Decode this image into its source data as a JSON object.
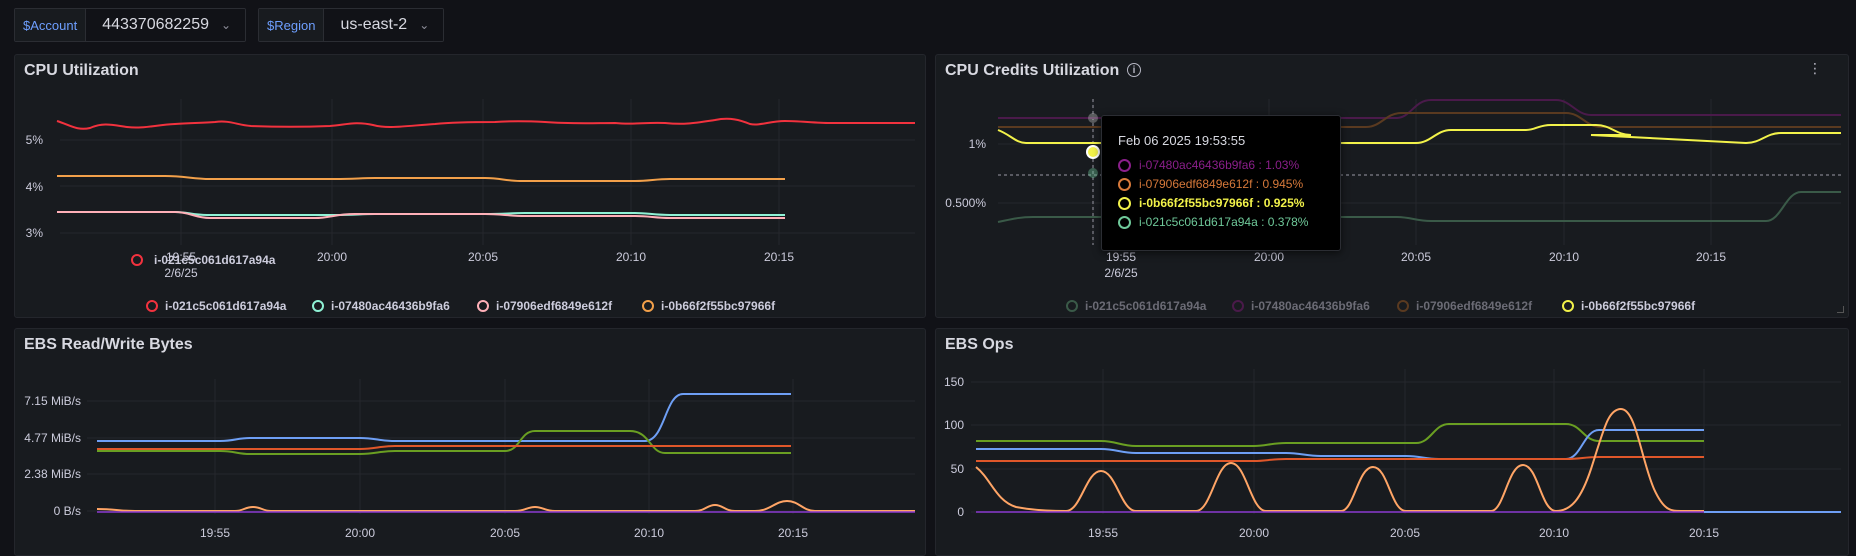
{
  "variables": [
    {
      "label": "$Account",
      "value": "443370682259"
    },
    {
      "label": "$Region",
      "value": "us-east-2"
    }
  ],
  "panels": {
    "cpu": {
      "title": "CPU Utilization",
      "y_ticks": [
        "5%",
        "4%",
        "3%"
      ],
      "x_ticks": [
        "19:55",
        "20:00",
        "20:05",
        "20:10",
        "20:15"
      ],
      "x_date": "2/6/25",
      "legend": [
        "i-021c5c061d617a94a",
        "i-07480ac46436b9fa6",
        "i-07906edf6849e612f",
        "i-0b66f2f55bc97966f"
      ]
    },
    "credits": {
      "title": "CPU Credits Utilization",
      "y_ticks": [
        "1%",
        "0.500%"
      ],
      "x_ticks": [
        "19:55",
        "20:00",
        "20:05",
        "20:10",
        "20:15"
      ],
      "x_date": "2/6/25",
      "legend": [
        "i-021c5c061d617a94a",
        "i-07480ac46436b9fa6",
        "i-07906edf6849e612f",
        "i-0b66f2f55bc97966f"
      ],
      "tooltip": {
        "time": "Feb 06 2025 19:53:55",
        "rows": [
          {
            "label": "i-07480ac46436b9fa6 : 1.03%",
            "color": "#8a1f8a",
            "bold": false
          },
          {
            "label": "i-07906edf6849e612f : 0.945%",
            "color": "#d7793a",
            "bold": false
          },
          {
            "label": "i-0b66f2f55bc97966f : 0.925%",
            "color": "#f2f24a",
            "bold": true
          },
          {
            "label": "i-021c5c061d617a94a : 0.378%",
            "color": "#6fc99a",
            "bold": false
          }
        ]
      }
    },
    "ebsbytes": {
      "title": "EBS Read/Write Bytes",
      "y_ticks": [
        "7.15 MiB/s",
        "4.77 MiB/s",
        "2.38 MiB/s",
        "0 B/s"
      ],
      "x_ticks": [
        "19:55",
        "20:00",
        "20:05",
        "20:10",
        "20:15"
      ]
    },
    "ebsops": {
      "title": "EBS Ops",
      "y_ticks": [
        "150",
        "100",
        "50",
        "0"
      ],
      "x_ticks": [
        "19:55",
        "20:00",
        "20:05",
        "20:10",
        "20:15"
      ]
    }
  },
  "colors": {
    "red": "#f2323e",
    "mint": "#8ff2d5",
    "pink": "#ffb0b8",
    "orange": "#f2a04a",
    "yellow": "#f2f24a",
    "blue": "#6e9ff5",
    "green": "#6a9f22",
    "red_orange": "#e0572a",
    "purple": "#8a3ad0",
    "peach": "#ffa566",
    "grid": "#25272c"
  }
}
